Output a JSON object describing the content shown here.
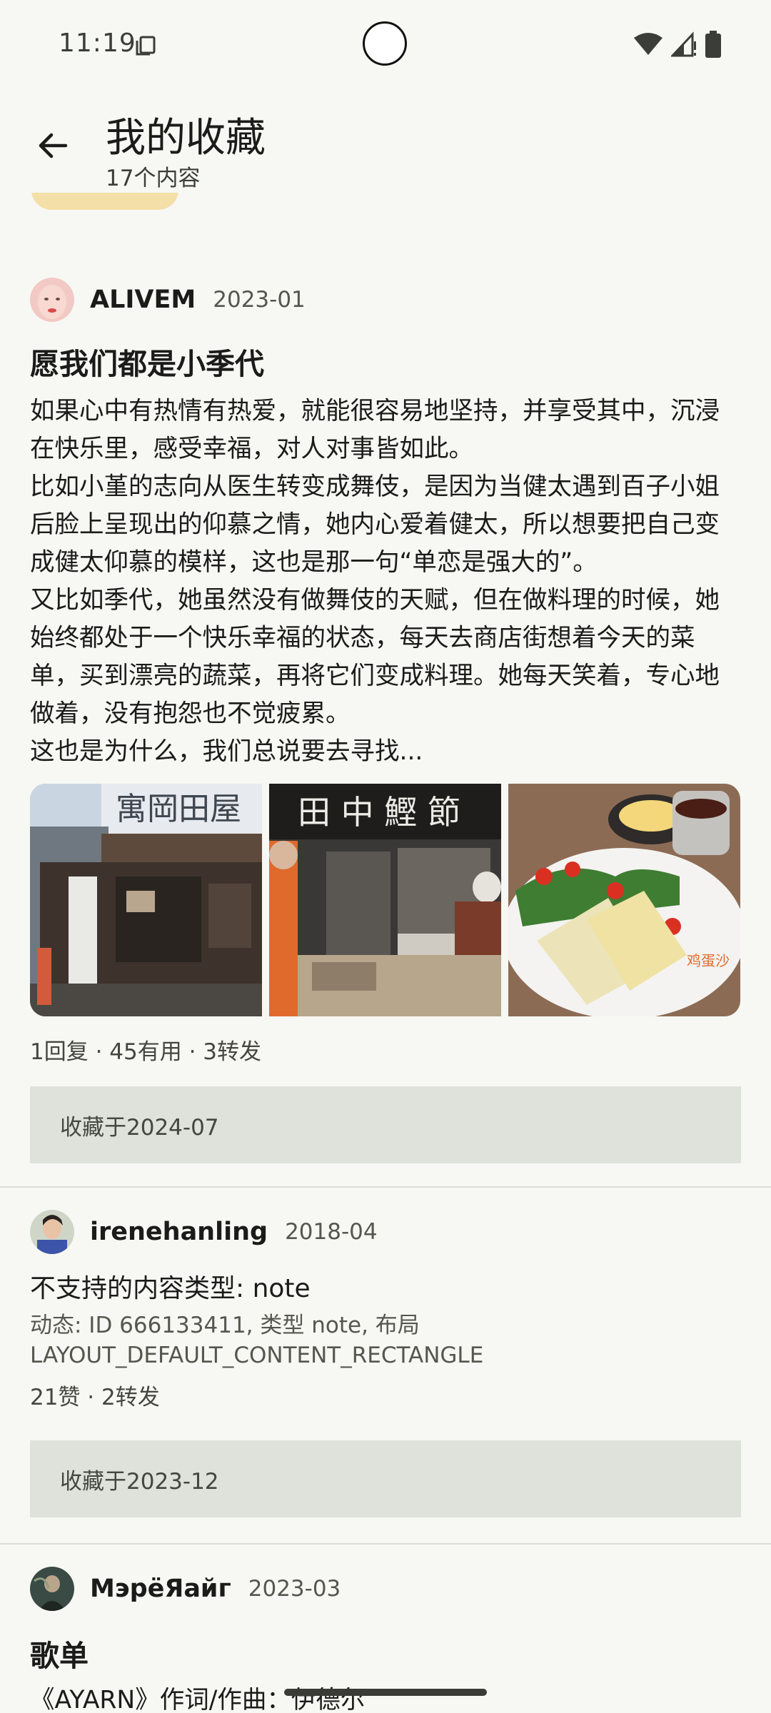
{
  "status_bar": {
    "time": "11:19",
    "icons": [
      "screenshot-icon",
      "wifi-icon",
      "signal-icon",
      "battery-icon"
    ]
  },
  "header": {
    "title": "我的收藏",
    "subtitle": "17个内容",
    "back_icon": "arrow-left-icon"
  },
  "posts": [
    {
      "author": "ALIVEM",
      "date": "2023-01",
      "title": "愿我们都是小季代",
      "paragraphs": [
        "如果心中有热情有热爱，就能很容易地坚持，并享受其中，沉浸在快乐里，感受幸福，对人对事皆如此。",
        "比如小堇的志向从医生转变成舞伎，是因为当健太遇到百子小姐后脸上呈现出的仰慕之情，她内心爱着健太，所以想要把自己变成健太仰慕的模样，这也是那一句“单恋是强大的”。",
        "又比如季代，她虽然没有做舞伎的天赋，但在做料理的时候，她始终都处于一个快乐幸福的状态，每天去商店街想着今天的菜单，买到漂亮的蔬菜，再将它们变成料理。她每天笑着，专心地做着，没有抱怨也不觉疲累。",
        "这也是为什么，我们总说要去寻找..."
      ],
      "images": [
        "shop-storefront-photo",
        "bonito-shop-photo",
        "egg-sandwich-photo"
      ],
      "stats": "1回复 · 45有用 · 3转发",
      "collected": "收藏于2024-07"
    },
    {
      "author": "irenehanling",
      "date": "2018-04",
      "unsupported_title": "不支持的内容类型: note",
      "unsupported_detail": "动态: ID 666133411, 类型 note, 布局 LAYOUT_DEFAULT_CONTENT_RECTANGLE",
      "stats": "21赞 · 2转发",
      "collected": "收藏于2023-12"
    },
    {
      "author": "МэрёЯaйг",
      "date": "2023-03",
      "title": "歌单",
      "body_first_line": "《AYARN》作词/作曲：伊德尔"
    }
  ],
  "colors": {
    "background": "#f7f8f3",
    "collected_box": "#dee2da",
    "tag_yellow": "#f5dfa8"
  }
}
